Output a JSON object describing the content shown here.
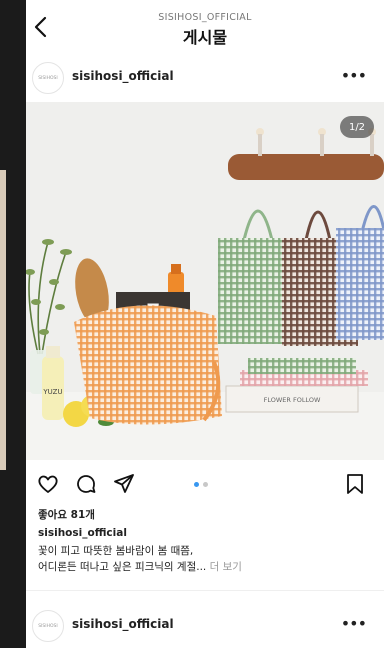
{
  "header": {
    "account": "SISIHOSI_OFFICIAL",
    "title": "게시물"
  },
  "post": {
    "username": "sisihosi_official",
    "avatar_text": "SISIHOSI",
    "page_indicator": "1/2",
    "photo_text": {
      "box_letter": "F",
      "lemon_label": "YUZU",
      "book_title": "FLOWER FOLLOW"
    },
    "likes": "좋아요 81개",
    "caption_user": "sisihosi_official",
    "caption_line1": "꽃이 피고 따뜻한 봄바람이 봄 때쯤,",
    "caption_line2": "어디론든 떠나고 싶은 피크닉의 계절...",
    "more_label": "더 보기",
    "carousel": {
      "count": 2,
      "active": 1
    }
  },
  "next_post": {
    "username": "sisihosi_official",
    "avatar_text": "SISIHOSI"
  },
  "icons": [
    "back-icon",
    "more-icon",
    "heart-icon",
    "comment-icon",
    "share-icon",
    "bookmark-icon"
  ],
  "colors": {
    "accent": "#3897f0",
    "text": "#222222"
  }
}
